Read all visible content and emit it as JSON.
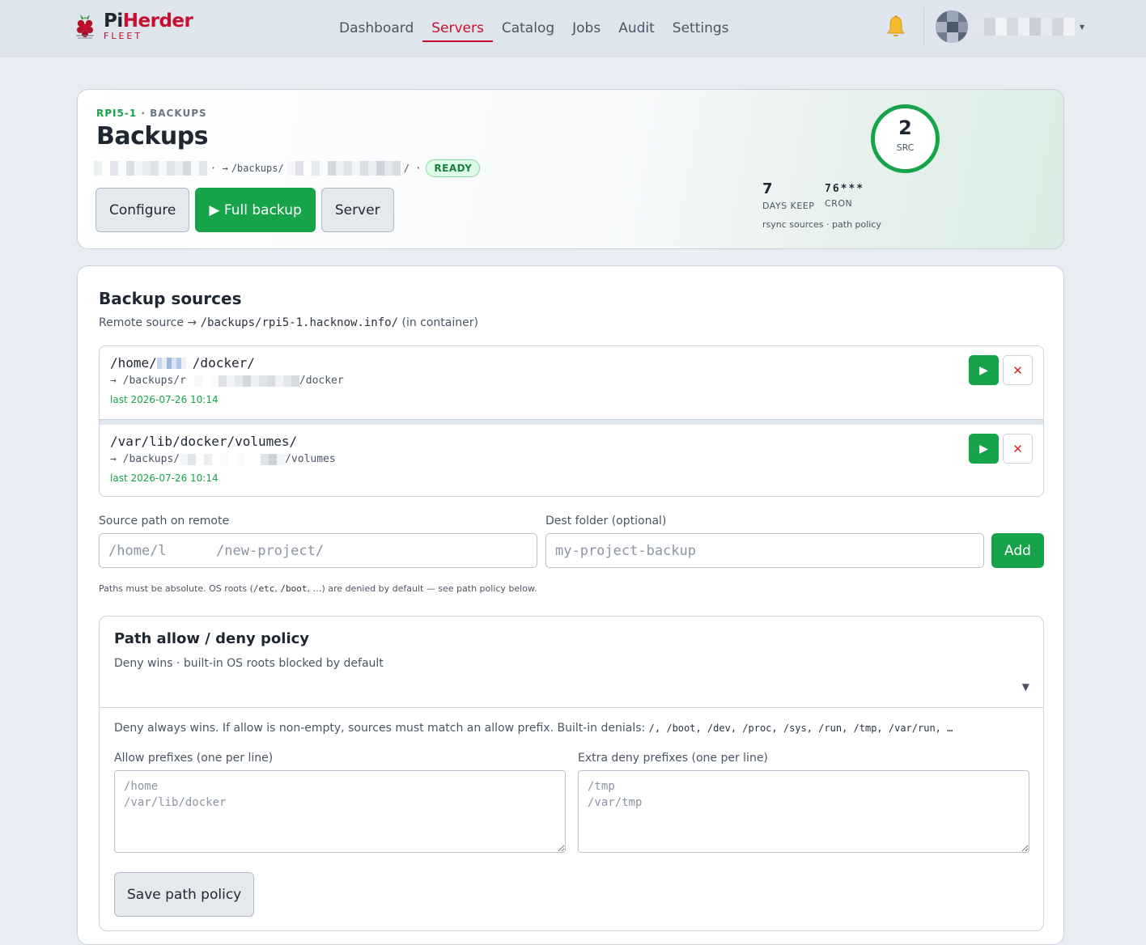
{
  "brand": {
    "name_part1": "Pi",
    "name_part2": "Herder",
    "subtitle": "FLEET",
    "icon": "raspberry-icon"
  },
  "nav": {
    "items": [
      {
        "label": "Dashboard",
        "active": false
      },
      {
        "label": "Servers",
        "active": true
      },
      {
        "label": "Catalog",
        "active": false
      },
      {
        "label": "Jobs",
        "active": false
      },
      {
        "label": "Audit",
        "active": false
      },
      {
        "label": "Settings",
        "active": false
      }
    ],
    "notification_icon": "bell-icon",
    "user_menu_icon": "chevron-down-icon",
    "user_menu_caret": "▾"
  },
  "hero": {
    "host": "RPI5-1",
    "separator": "·",
    "section": "BACKUPS",
    "title": "Backups",
    "path_arrow": "· →",
    "path_prefix": "/backups/",
    "path_suffix": "/ ·",
    "status": "READY",
    "actions": {
      "configure": "Configure",
      "full_backup": "▶ Full backup",
      "server": "Server"
    },
    "ring": {
      "value": "2",
      "label": "SRC"
    },
    "stats": [
      {
        "value": "7",
        "label": "DAYS KEEP"
      },
      {
        "value": "76***",
        "label": "CRON"
      }
    ],
    "note": "rsync sources · path policy"
  },
  "sources": {
    "title": "Backup sources",
    "subtitle_prefix": "Remote source →",
    "subtitle_path": "/backups/rpi5-1.hacknow.info/",
    "subtitle_suffix": "(in container)",
    "items": [
      {
        "path_prefix": "/home/",
        "path_suffix": "/docker/",
        "dest_prefix": "→ /backups/r",
        "dest_suffix": "/docker",
        "last": "last 2026-07-26 10:14"
      },
      {
        "path_prefix": "/var/lib/docker/volumes/",
        "path_suffix": "",
        "dest_prefix": "→ /backups/",
        "dest_suffix": "/volumes",
        "last": "last 2026-07-26 10:14"
      }
    ],
    "run_glyph": "▶",
    "delete_glyph": "✕"
  },
  "add_form": {
    "source_label": "Source path on remote",
    "source_placeholder": "/home/l      /new-project/",
    "dest_label": "Dest folder (optional)",
    "dest_placeholder": "my-project-backup",
    "add_label": "Add",
    "hint_prefix": "Paths must be absolute. OS roots (",
    "hint_code1": "/etc",
    "hint_sep": ",",
    "hint_code2": "/boot",
    "hint_suffix": ", …) are denied by default — see path policy below."
  },
  "policy": {
    "title": "Path allow / deny policy",
    "subtitle": "Deny wins · built-in OS roots blocked by default",
    "caret": "▼",
    "desc_prefix": "Deny always wins. If allow is non-empty, sources must match an allow prefix. Built-in denials:",
    "desc_code": "/,  /boot,  /dev,  /proc,  /sys,  /run,  /tmp,  /var/run,  …",
    "allow_label": "Allow prefixes (one per line)",
    "allow_placeholder": "/home\n/var/lib/docker",
    "deny_label": "Extra deny prefixes (one per line)",
    "deny_placeholder": "/tmp\n/var/tmp",
    "save_label": "Save path policy"
  },
  "colors": {
    "accent_green": "#16a34a",
    "brand_red": "#c8102e",
    "page_bg": "#e8edf3"
  }
}
